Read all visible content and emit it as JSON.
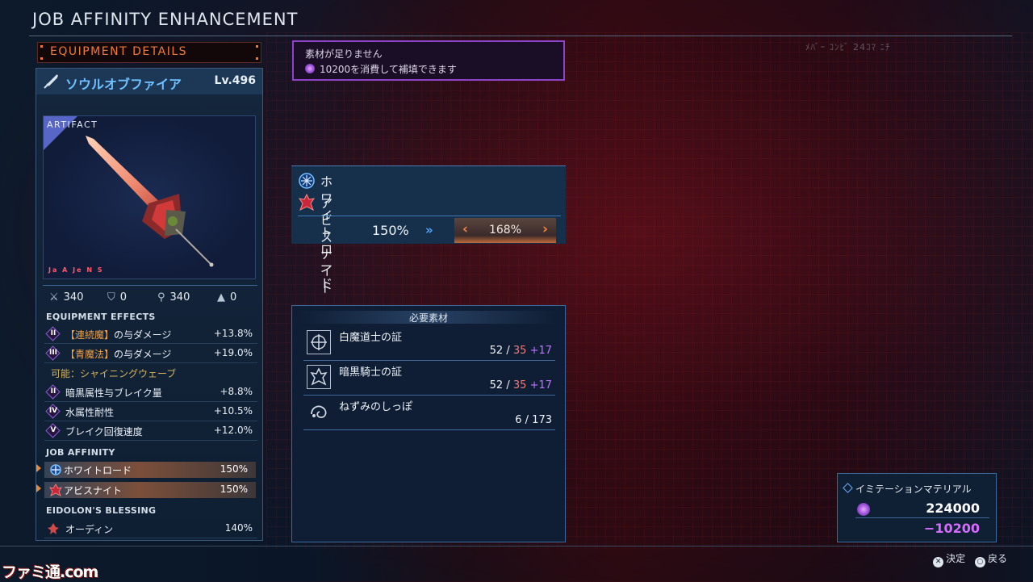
{
  "screen_title": "JOB AFFINITY ENHANCEMENT",
  "faint_text": "ﾒﾊﾞｰ ｺﾝﾋﾞ 24ｺﾏ ﾆﾁ",
  "left": {
    "header": "EQUIPMENT DETAILS",
    "weapon_name": "ソウルオブファイア",
    "weapon_level": "Lv.496",
    "artifact_label": "ARTIFACT",
    "job_tags": "Ja A Je N S",
    "stats": [
      "340",
      "0",
      "340",
      "0"
    ],
    "effects_title": "EQUIPMENT EFFECTS",
    "effects": [
      {
        "rank": "II",
        "label_bracket": "【連続魔】",
        "label_rest": "の与ダメージ",
        "value": "+13.8%"
      },
      {
        "rank": "III",
        "label_bracket": "【青魔法】",
        "label_rest": "の与ダメージ",
        "value": "+19.0%"
      }
    ],
    "ability_note": "可能：シャイニングウェーブ",
    "effects2": [
      {
        "rank": "II",
        "label": "暗黒属性与ブレイク量",
        "value": "+8.8%"
      },
      {
        "rank": "IV",
        "label": "水属性耐性",
        "value": "+10.5%"
      },
      {
        "rank": "V",
        "label": "ブレイク回復速度",
        "value": "+12.0%"
      }
    ],
    "job_affinity_title": "JOB AFFINITY",
    "job_affinity": [
      {
        "label": "ホワイトロード",
        "value": "150%"
      },
      {
        "label": "アビスナイト",
        "value": "150%"
      }
    ],
    "eidolon_title": "EIDOLON'S BLESSING",
    "eidolon": {
      "label": "オーディン",
      "value": "140%"
    }
  },
  "shortage": {
    "line1": "素材が足りません",
    "line2": "10200を消費して補填できます"
  },
  "affinity": {
    "job1": "ホワイトロード",
    "job2": "アビスナイト",
    "current": "150%",
    "arrow": "»",
    "next": "168%",
    "left_arrow": "‹",
    "right_arrow": "›"
  },
  "materials": {
    "title": "必要素材",
    "items": [
      {
        "name": "白魔道士の証",
        "have": "52",
        "slash": "/",
        "need": "35",
        "bonus": "+17"
      },
      {
        "name": "暗黒騎士の証",
        "have": "52",
        "slash": "/",
        "need": "35",
        "bonus": "+17"
      },
      {
        "name": "ねずみのしっぽ",
        "have": "6",
        "slash": "/",
        "need": "173",
        "bonus": ""
      }
    ]
  },
  "currency": {
    "name": "イミテーションマテリアル",
    "amount": "224000",
    "cost": "−10200"
  },
  "hints": {
    "confirm": "決定",
    "back": "戻る"
  },
  "watermark": "ファミ通.com",
  "colors": {
    "accent_orange": "#f07a3a",
    "accent_purple": "#8d44c8",
    "cost_purple": "#d66cff"
  }
}
